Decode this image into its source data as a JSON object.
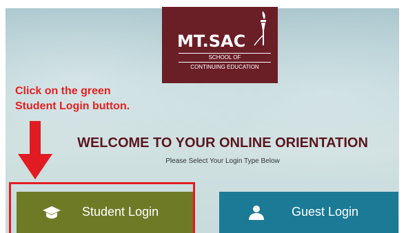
{
  "logo": {
    "main_text": "MT.SAC",
    "sub_line1": "SCHOOL OF",
    "sub_line2": "CONTINUING EDUCATION"
  },
  "annotation": {
    "line1": "Click on the green",
    "line2": "Student Login button."
  },
  "heading": {
    "title": "WELCOME TO YOUR ONLINE ORIENTATION",
    "subtitle": "Please Select Your Login Type Below"
  },
  "buttons": {
    "student_label": "Student Login",
    "guest_label": "Guest Login",
    "student_icon": "graduation-cap-icon",
    "guest_icon": "user-icon"
  },
  "colors": {
    "brand": "#6a1e26",
    "student_button": "#6f7a27",
    "guest_button": "#1b7a95",
    "annotation_red": "#e21b22"
  }
}
